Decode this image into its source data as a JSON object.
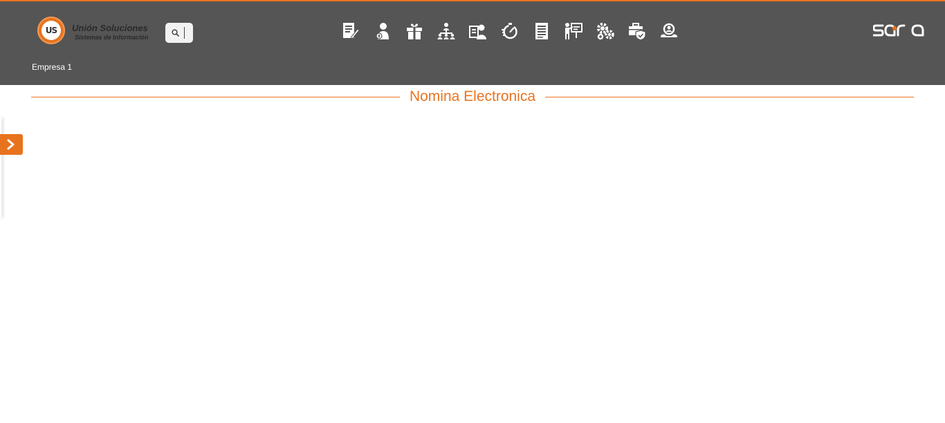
{
  "header": {
    "logo": {
      "badge_text": "US",
      "title": "Unión Soluciones",
      "subtitle": "Sistemas de Información"
    },
    "search": {
      "icon": "search-icon"
    },
    "menu_icons": [
      {
        "name": "document-edit-icon"
      },
      {
        "name": "employee-icon"
      },
      {
        "name": "gift-icon"
      },
      {
        "name": "hierarchy-icon"
      },
      {
        "name": "id-card-user-icon"
      },
      {
        "name": "stopwatch-icon"
      },
      {
        "name": "report-icon"
      },
      {
        "name": "presentation-icon"
      },
      {
        "name": "gears-icon"
      },
      {
        "name": "briefcase-shield-icon"
      },
      {
        "name": "user-search-icon"
      }
    ],
    "brand": "sara",
    "company": "Empresa 1"
  },
  "main": {
    "section_title": "Nomina Electronica"
  },
  "sidebar": {
    "toggle_icon": "chevron-right-icon"
  },
  "colors": {
    "accent": "#e8731f",
    "topbar": "#555555",
    "icon": "#ffffff"
  }
}
